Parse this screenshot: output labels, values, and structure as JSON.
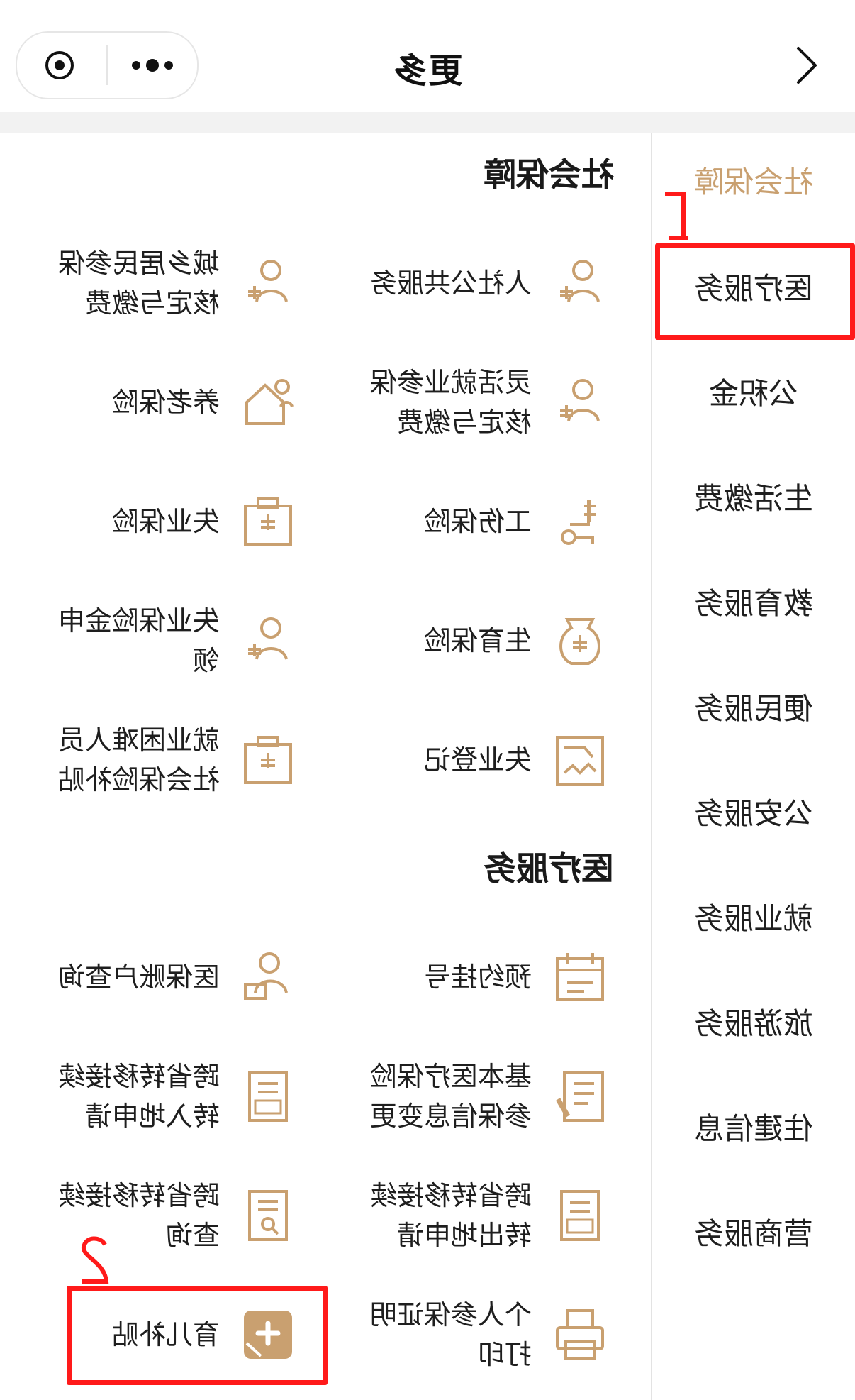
{
  "header": {
    "title": "更多",
    "more_icon": "more-dots-icon",
    "target_icon": "target-icon",
    "chevron_icon": "chevron-right-icon"
  },
  "sidebar": {
    "items": [
      {
        "label": "社会保障",
        "active": true
      },
      {
        "label": "医疗服务",
        "active": false
      },
      {
        "label": "公积金",
        "active": false
      },
      {
        "label": "生活缴费",
        "active": false
      },
      {
        "label": "教育服务",
        "active": false
      },
      {
        "label": "便民服务",
        "active": false
      },
      {
        "label": "公安服务",
        "active": false
      },
      {
        "label": "就业服务",
        "active": false
      },
      {
        "label": "旅游服务",
        "active": false
      },
      {
        "label": "住建信息",
        "active": false
      },
      {
        "label": "营商服务",
        "active": false
      }
    ]
  },
  "sections": [
    {
      "title": "社会保障",
      "items": [
        {
          "label": "人社公共服务",
          "icon": "person-plus-icon"
        },
        {
          "label": "城乡居民参保核定与缴费",
          "icon": "person-plus-icon"
        },
        {
          "label": "灵活就业参保核定与缴费",
          "icon": "person-plus-icon"
        },
        {
          "label": "养老保险",
          "icon": "house-person-icon"
        },
        {
          "label": "工伤保险",
          "icon": "wheelchair-icon"
        },
        {
          "label": "失业保险",
          "icon": "medical-kit-icon"
        },
        {
          "label": "生育保险",
          "icon": "money-bag-icon"
        },
        {
          "label": "失业保险金申领",
          "icon": "person-plus-icon"
        },
        {
          "label": "失业登记",
          "icon": "document-chart-icon"
        },
        {
          "label": "就业困难人员社会保险补贴",
          "icon": "medical-kit-icon"
        }
      ]
    },
    {
      "title": "医疗服务",
      "items": [
        {
          "label": "预约挂号",
          "icon": "calendar-icon"
        },
        {
          "label": "医保账户查询",
          "icon": "person-card-icon"
        },
        {
          "label": "基本医疗保险参保信息变更",
          "icon": "document-edit-icon"
        },
        {
          "label": "跨省转移接续转入地申请",
          "icon": "transfer-in-doc-icon"
        },
        {
          "label": "跨省转移接续转出地申请",
          "icon": "transfer-out-doc-icon"
        },
        {
          "label": "跨省转移接续查询",
          "icon": "doc-search-icon"
        },
        {
          "label": "个人参保证明打印",
          "icon": "printer-icon"
        },
        {
          "label": "育儿补贴",
          "icon": "childcare-plus-icon"
        }
      ]
    }
  ],
  "annotations": {
    "marker_1": "1",
    "marker_2": "2",
    "highlight_color": "#ff1a1a"
  },
  "colors": {
    "accent": "#c9a070",
    "icon": "#c9a070",
    "highlight": "#ff1a1a"
  }
}
